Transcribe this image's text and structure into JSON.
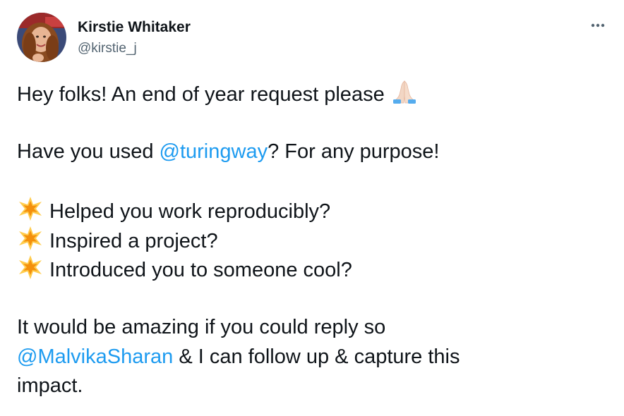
{
  "author": {
    "name": "Kirstie Whitaker",
    "handle": "@kirstie_j"
  },
  "more_menu": {
    "icon": "more-horizontal-icon",
    "label": "···"
  },
  "tweet": {
    "line1": {
      "text": "Hey folks! An end of year request please",
      "emoji": "folded-hands-emoji"
    },
    "line2": {
      "prefix": "Have you used ",
      "mention": "@turingway",
      "suffix": "? For any purpose!"
    },
    "bullets": [
      {
        "emoji": "glowing-star-emoji",
        "text": "Helped you work reproducibly?"
      },
      {
        "emoji": "glowing-star-emoji",
        "text": "Inspired a project?"
      },
      {
        "emoji": "glowing-star-emoji",
        "text": "Introduced you to someone cool?"
      }
    ],
    "closing": {
      "line1": "It would be amazing if you could reply  so",
      "mention": "@MalvikaSharan",
      "line2_suffix": " & I can follow up & capture this",
      "line3": "impact."
    }
  },
  "colors": {
    "text": "#0f1419",
    "secondary": "#536471",
    "link": "#1d9bf0"
  }
}
